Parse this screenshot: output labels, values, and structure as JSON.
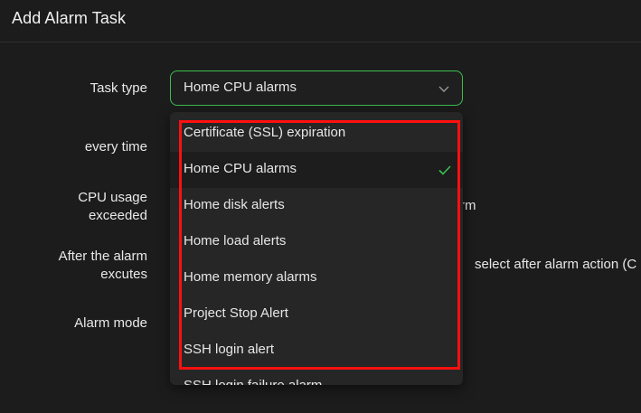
{
  "header": {
    "title": "Add Alarm Task"
  },
  "form": {
    "task_type_label": "Task type",
    "every_time_label": "every time",
    "cpu_usage_label_line1": "CPU usage",
    "cpu_usage_label_line2": "exceeded",
    "after_alarm_label_line1": "After the alarm",
    "after_alarm_label_line2": "excutes",
    "alarm_mode_label": "Alarm mode",
    "task_type_value": "Home CPU alarms",
    "behind_text_rm": "rm",
    "behind_text_action": "select after alarm action (C"
  },
  "dropdown": {
    "options": [
      {
        "label": "Certificate (SSL) expiration"
      },
      {
        "label": "Home CPU alarms"
      },
      {
        "label": "Home disk alerts"
      },
      {
        "label": "Home load alerts"
      },
      {
        "label": "Home memory alarms"
      },
      {
        "label": "Project Stop Alert"
      },
      {
        "label": "SSH login alert"
      },
      {
        "label": "SSH login failure alarm"
      }
    ],
    "selected_index": 1
  },
  "colors": {
    "accent": "#3bbf4f",
    "highlight": "#ff1010",
    "background": "#1c1c1c",
    "dropdown_bg": "#262626"
  },
  "icons": {
    "select_chevron": "chevron-down-icon",
    "selected_check": "check-icon"
  }
}
